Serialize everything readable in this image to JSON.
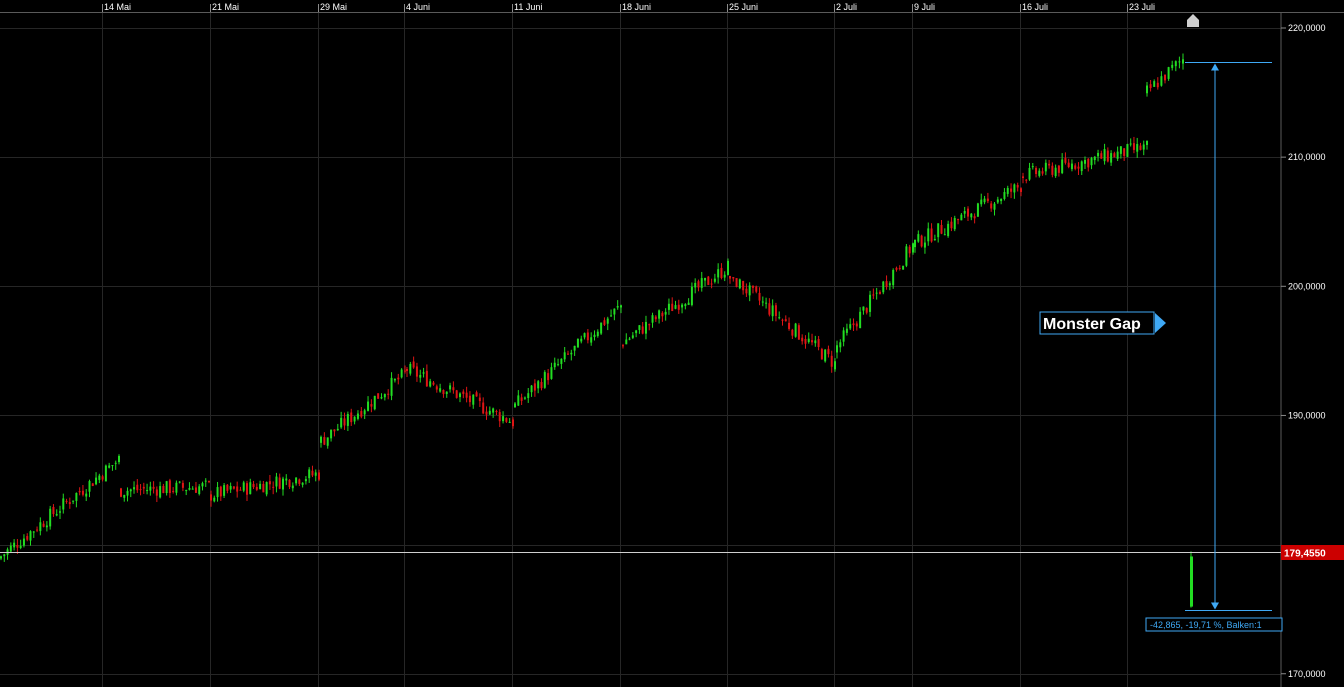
{
  "chart_data": {
    "type": "candlestick",
    "x_tick_labels": [
      "14 Mai",
      "21 Mai",
      "29 Mai",
      "4 Juni",
      "11 Juni",
      "18 Juni",
      "25 Juni",
      "2 Juli",
      "9 Juli",
      "16 Juli",
      "23 Juli"
    ],
    "y_tick_labels": [
      "220,0000",
      "210,0000",
      "200,0000",
      "190,0000",
      "170,0000"
    ],
    "ylim": [
      168.8,
      222.8
    ],
    "grid": true,
    "current_price_label": "179,4550",
    "current_price": 179.455,
    "annotation": "Monster Gap",
    "measure_label": "-42,865, -19,71 %, Balken:1",
    "gap_range": [
      174.9,
      217.4
    ],
    "colors": {
      "up": "#22dd22",
      "down": "#e01515",
      "grid": "#262626",
      "measure": "#3fa9f5",
      "price_badge": "#cc0000"
    },
    "series": [
      {
        "segment": 1,
        "start_x": "before 14 Mai",
        "end_x": "14 Mai",
        "start": 178.9,
        "end": 186.6,
        "low": 177.9,
        "high": 188.4
      },
      {
        "segment": 2,
        "start_x": "14 Mai",
        "end_x": "21 Mai",
        "start": 184.2,
        "end": 184.5,
        "low": 182.5,
        "high": 185.5
      },
      {
        "segment": 3,
        "start_x": "21 Mai",
        "end_x": "29 Mai",
        "start": 183.8,
        "end": 185.5,
        "low": 182.7,
        "high": 187.2
      },
      {
        "segment": 4,
        "start_x": "29 Mai",
        "end_x": "4 Juni",
        "start": 187.8,
        "end": 193.2,
        "low": 186.5,
        "high": 195.0
      },
      {
        "segment": 5,
        "start_x": "4 Juni",
        "end_x": "11 Juni",
        "start": 193.7,
        "end": 189.5,
        "low": 186.8,
        "high": 194.8
      },
      {
        "segment": 6,
        "start_x": "11 Juni",
        "end_x": "18 Juni",
        "start": 190.5,
        "end": 198.5,
        "low": 189.8,
        "high": 199.4
      },
      {
        "segment": 7,
        "start_x": "18 Juni",
        "end_x": "25 Juni",
        "start": 195.5,
        "end": 201.5,
        "low": 194.3,
        "high": 203.3
      },
      {
        "segment": 8,
        "start_x": "25 Juni",
        "end_x": "2 Juli",
        "start": 201.0,
        "end": 194.0,
        "low": 192.3,
        "high": 200.6
      },
      {
        "segment": 9,
        "start_x": "2 Juli",
        "end_x": "9 Juli",
        "start": 195.0,
        "end": 203.2,
        "low": 192.3,
        "high": 205.7
      },
      {
        "segment": 10,
        "start_x": "9 Juli",
        "end_x": "16 Juli",
        "start": 203.2,
        "end": 207.8,
        "low": 201.8,
        "high": 209.5
      },
      {
        "segment": 11,
        "start_x": "16 Juli",
        "end_x": "23 Juli",
        "start": 208.5,
        "end": 210.8,
        "low": 207.6,
        "high": 211.6
      },
      {
        "segment": 12,
        "start_x": "23 Juli",
        "end_x": "23 Juli",
        "start": 214.8,
        "end": 217.6,
        "low": 212.4,
        "high": 218.3
      },
      {
        "segment": 13,
        "start_x": "after 23 Juli",
        "end_x": "after 23 Juli",
        "start": 175.2,
        "end": 179.4,
        "low": 174.9,
        "high": 179.6
      }
    ]
  }
}
